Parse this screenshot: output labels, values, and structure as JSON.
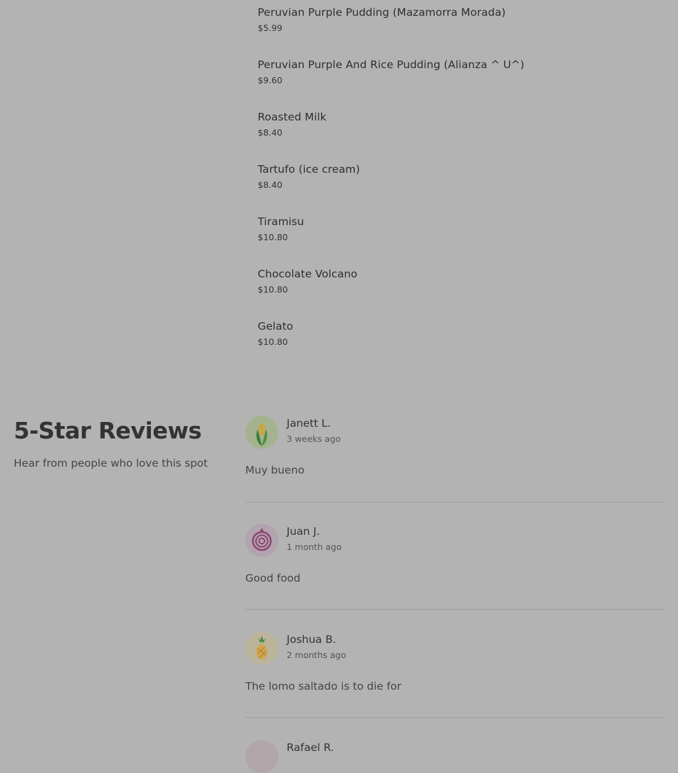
{
  "menu": {
    "items": [
      {
        "name": "Peruvian Purple Pudding (Mazamorra Morada)",
        "price": "$5.99"
      },
      {
        "name": "Peruvian Purple And Rice Pudding (Alianza ^ U^)",
        "price": "$9.60"
      },
      {
        "name": "Roasted Milk",
        "price": "$8.40"
      },
      {
        "name": "Tartufo (ice cream)",
        "price": "$8.40"
      },
      {
        "name": "Tiramisu",
        "price": "$10.80"
      },
      {
        "name": "Chocolate Volcano",
        "price": "$10.80"
      },
      {
        "name": "Gelato",
        "price": "$10.80"
      }
    ]
  },
  "reviews": {
    "title": "5-Star Reviews",
    "subtitle": "Hear from people who love this spot",
    "items": [
      {
        "name": "Janett L.",
        "when": "3 weeks ago",
        "text": "Muy bueno",
        "avatar_icon": "corn-icon",
        "avatar_bg": "#a4b38e"
      },
      {
        "name": "Juan J.",
        "when": "1 month ago",
        "text": "Good food",
        "avatar_icon": "onion-icon",
        "avatar_bg": "#b2a3ae"
      },
      {
        "name": "Joshua B.",
        "when": "2 months ago",
        "text": "The lomo saltado is to die for",
        "avatar_icon": "pineapple-icon",
        "avatar_bg": "#bcb39b"
      },
      {
        "name": "Rafael R.",
        "avatar_bg": "#b3a6ab"
      }
    ]
  }
}
